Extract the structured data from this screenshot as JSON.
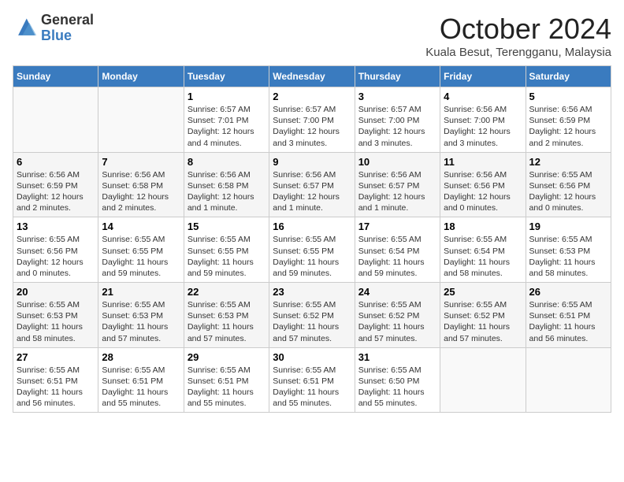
{
  "header": {
    "logo_general": "General",
    "logo_blue": "Blue",
    "month": "October 2024",
    "location": "Kuala Besut, Terengganu, Malaysia"
  },
  "days_of_week": [
    "Sunday",
    "Monday",
    "Tuesday",
    "Wednesday",
    "Thursday",
    "Friday",
    "Saturday"
  ],
  "weeks": [
    [
      {
        "day": "",
        "info": ""
      },
      {
        "day": "",
        "info": ""
      },
      {
        "day": "1",
        "info": "Sunrise: 6:57 AM\nSunset: 7:01 PM\nDaylight: 12 hours\nand 4 minutes."
      },
      {
        "day": "2",
        "info": "Sunrise: 6:57 AM\nSunset: 7:00 PM\nDaylight: 12 hours\nand 3 minutes."
      },
      {
        "day": "3",
        "info": "Sunrise: 6:57 AM\nSunset: 7:00 PM\nDaylight: 12 hours\nand 3 minutes."
      },
      {
        "day": "4",
        "info": "Sunrise: 6:56 AM\nSunset: 7:00 PM\nDaylight: 12 hours\nand 3 minutes."
      },
      {
        "day": "5",
        "info": "Sunrise: 6:56 AM\nSunset: 6:59 PM\nDaylight: 12 hours\nand 2 minutes."
      }
    ],
    [
      {
        "day": "6",
        "info": "Sunrise: 6:56 AM\nSunset: 6:59 PM\nDaylight: 12 hours\nand 2 minutes."
      },
      {
        "day": "7",
        "info": "Sunrise: 6:56 AM\nSunset: 6:58 PM\nDaylight: 12 hours\nand 2 minutes."
      },
      {
        "day": "8",
        "info": "Sunrise: 6:56 AM\nSunset: 6:58 PM\nDaylight: 12 hours\nand 1 minute."
      },
      {
        "day": "9",
        "info": "Sunrise: 6:56 AM\nSunset: 6:57 PM\nDaylight: 12 hours\nand 1 minute."
      },
      {
        "day": "10",
        "info": "Sunrise: 6:56 AM\nSunset: 6:57 PM\nDaylight: 12 hours\nand 1 minute."
      },
      {
        "day": "11",
        "info": "Sunrise: 6:56 AM\nSunset: 6:56 PM\nDaylight: 12 hours\nand 0 minutes."
      },
      {
        "day": "12",
        "info": "Sunrise: 6:55 AM\nSunset: 6:56 PM\nDaylight: 12 hours\nand 0 minutes."
      }
    ],
    [
      {
        "day": "13",
        "info": "Sunrise: 6:55 AM\nSunset: 6:56 PM\nDaylight: 12 hours\nand 0 minutes."
      },
      {
        "day": "14",
        "info": "Sunrise: 6:55 AM\nSunset: 6:55 PM\nDaylight: 11 hours\nand 59 minutes."
      },
      {
        "day": "15",
        "info": "Sunrise: 6:55 AM\nSunset: 6:55 PM\nDaylight: 11 hours\nand 59 minutes."
      },
      {
        "day": "16",
        "info": "Sunrise: 6:55 AM\nSunset: 6:55 PM\nDaylight: 11 hours\nand 59 minutes."
      },
      {
        "day": "17",
        "info": "Sunrise: 6:55 AM\nSunset: 6:54 PM\nDaylight: 11 hours\nand 59 minutes."
      },
      {
        "day": "18",
        "info": "Sunrise: 6:55 AM\nSunset: 6:54 PM\nDaylight: 11 hours\nand 58 minutes."
      },
      {
        "day": "19",
        "info": "Sunrise: 6:55 AM\nSunset: 6:53 PM\nDaylight: 11 hours\nand 58 minutes."
      }
    ],
    [
      {
        "day": "20",
        "info": "Sunrise: 6:55 AM\nSunset: 6:53 PM\nDaylight: 11 hours\nand 58 minutes."
      },
      {
        "day": "21",
        "info": "Sunrise: 6:55 AM\nSunset: 6:53 PM\nDaylight: 11 hours\nand 57 minutes."
      },
      {
        "day": "22",
        "info": "Sunrise: 6:55 AM\nSunset: 6:53 PM\nDaylight: 11 hours\nand 57 minutes."
      },
      {
        "day": "23",
        "info": "Sunrise: 6:55 AM\nSunset: 6:52 PM\nDaylight: 11 hours\nand 57 minutes."
      },
      {
        "day": "24",
        "info": "Sunrise: 6:55 AM\nSunset: 6:52 PM\nDaylight: 11 hours\nand 57 minutes."
      },
      {
        "day": "25",
        "info": "Sunrise: 6:55 AM\nSunset: 6:52 PM\nDaylight: 11 hours\nand 57 minutes."
      },
      {
        "day": "26",
        "info": "Sunrise: 6:55 AM\nSunset: 6:51 PM\nDaylight: 11 hours\nand 56 minutes."
      }
    ],
    [
      {
        "day": "27",
        "info": "Sunrise: 6:55 AM\nSunset: 6:51 PM\nDaylight: 11 hours\nand 56 minutes."
      },
      {
        "day": "28",
        "info": "Sunrise: 6:55 AM\nSunset: 6:51 PM\nDaylight: 11 hours\nand 55 minutes."
      },
      {
        "day": "29",
        "info": "Sunrise: 6:55 AM\nSunset: 6:51 PM\nDaylight: 11 hours\nand 55 minutes."
      },
      {
        "day": "30",
        "info": "Sunrise: 6:55 AM\nSunset: 6:51 PM\nDaylight: 11 hours\nand 55 minutes."
      },
      {
        "day": "31",
        "info": "Sunrise: 6:55 AM\nSunset: 6:50 PM\nDaylight: 11 hours\nand 55 minutes."
      },
      {
        "day": "",
        "info": ""
      },
      {
        "day": "",
        "info": ""
      }
    ]
  ]
}
